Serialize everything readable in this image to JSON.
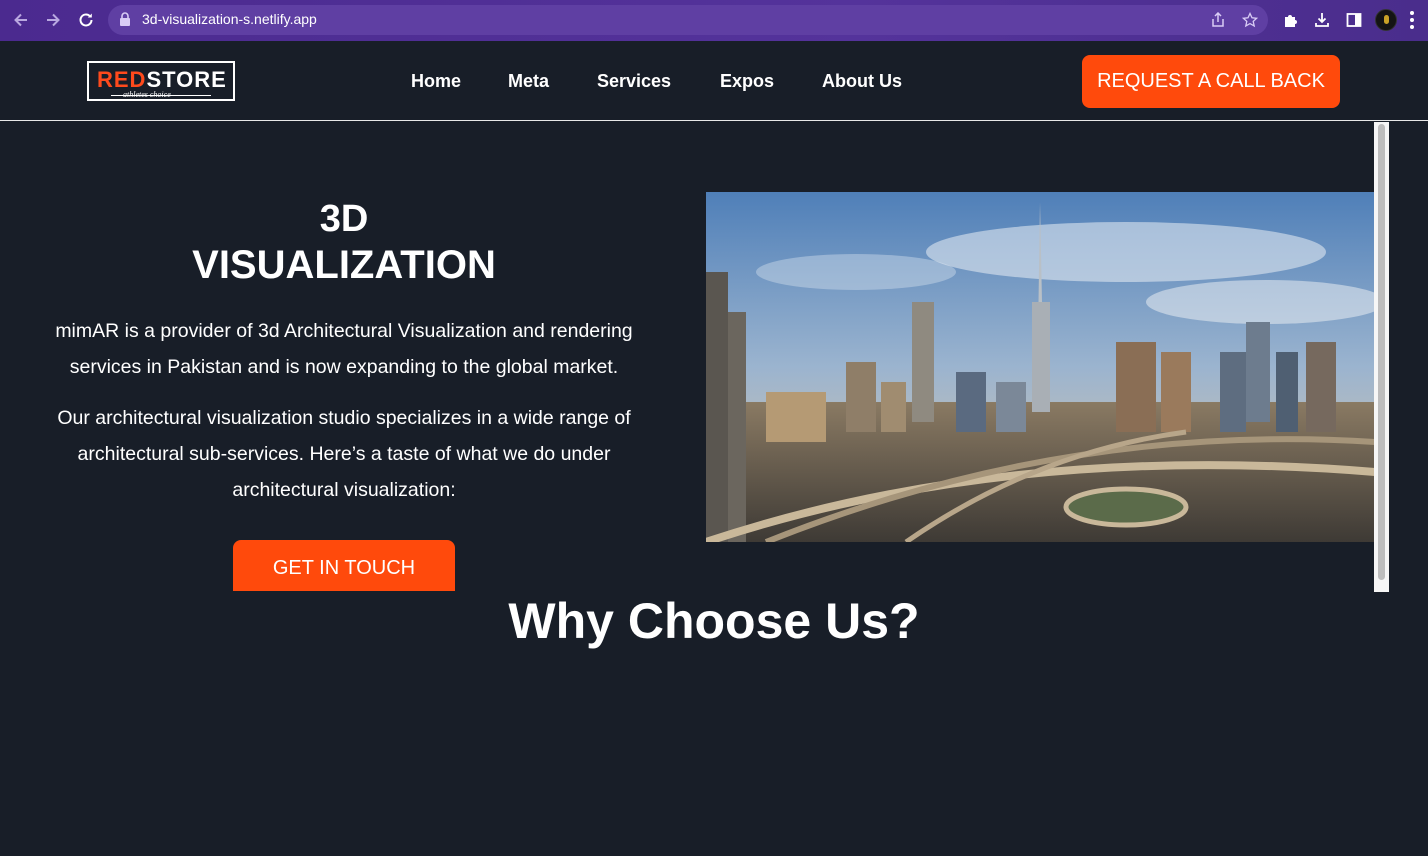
{
  "browser": {
    "url": "3d-visualization-s.netlify.app"
  },
  "header": {
    "logo": {
      "brand_red": "RED",
      "brand_white": "STORE",
      "tagline": "athletes choice"
    },
    "nav": [
      {
        "label": "Home"
      },
      {
        "label": "Meta"
      },
      {
        "label": "Services"
      },
      {
        "label": "Expos"
      },
      {
        "label": "About Us"
      }
    ],
    "cta_label": "REQUEST A CALL BACK"
  },
  "hero": {
    "title_line1": "3D",
    "title_line2": "VISUALIZATION",
    "paragraph1": "mimAR is a provider of 3d Architectural Visualization and rendering services in Pakistan and is now expanding to the global market.",
    "paragraph2": "Our architectural visualization studio specializes in a wide range of architectural sub-services. Here’s a taste of what we do under architectural visualization:",
    "button_label": "GET IN TOUCH"
  },
  "section": {
    "why_title": "Why Choose Us?"
  },
  "colors": {
    "accent": "#ff4a0c",
    "background": "#181e28",
    "chrome": "#4b2a8f"
  }
}
